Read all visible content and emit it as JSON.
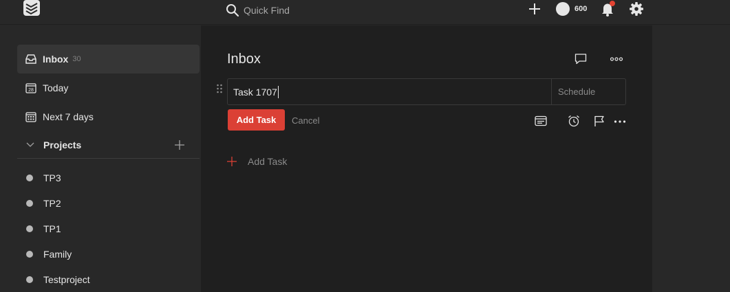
{
  "topbar": {
    "search_placeholder": "Quick Find",
    "karma": "600"
  },
  "sidebar": {
    "inbox": {
      "label": "Inbox",
      "count": "30"
    },
    "today": {
      "label": "Today",
      "date": "28"
    },
    "next7": {
      "label": "Next 7 days"
    },
    "projects_label": "Projects",
    "projects": [
      {
        "label": "TP3"
      },
      {
        "label": "TP2"
      },
      {
        "label": "TP1"
      },
      {
        "label": "Family"
      },
      {
        "label": "Testproject"
      }
    ]
  },
  "main": {
    "title": "Inbox",
    "editor": {
      "value": "Task 1707",
      "schedule_label": "Schedule"
    },
    "add_task_button": "Add Task",
    "cancel_label": "Cancel",
    "quick_add_label": "Add Task"
  },
  "colors": {
    "accent": "#db4035",
    "background": "#1f1f1f",
    "sidebar": "#282828",
    "notification": "#e44332"
  }
}
